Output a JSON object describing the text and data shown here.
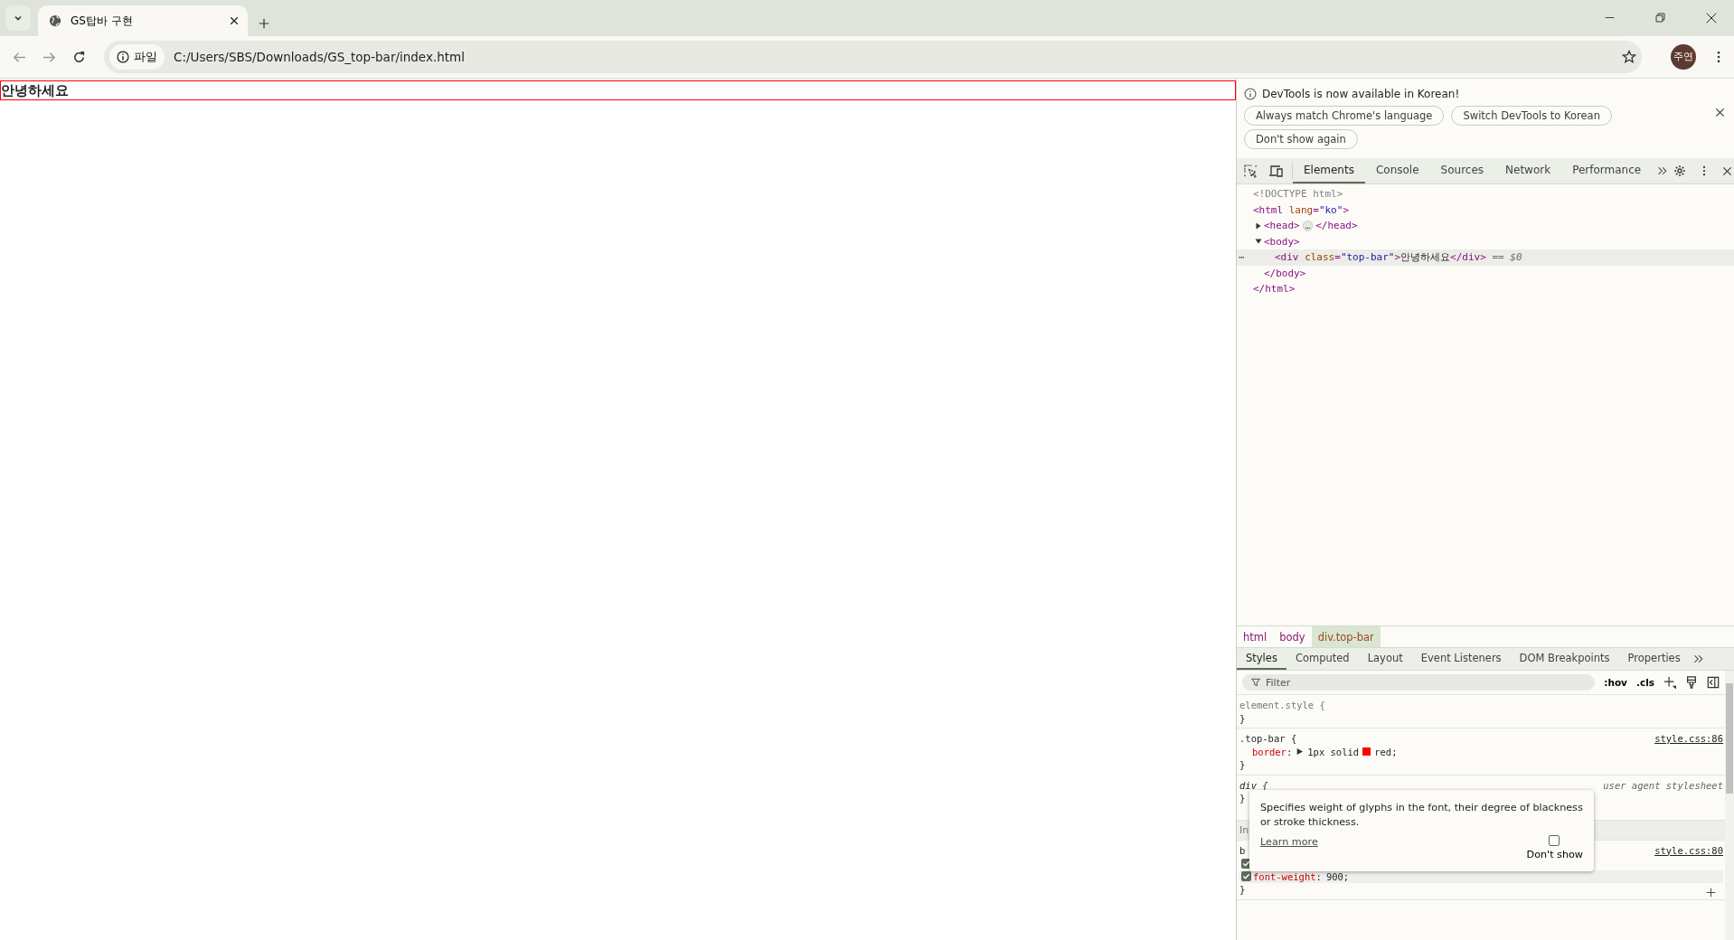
{
  "browser": {
    "tabs": [
      {
        "title": "GS탑바 구현",
        "selected": true
      }
    ],
    "address": {
      "chip": "파일",
      "url": "C:/Users/SBS/Downloads/GS_top-bar/index.html"
    },
    "profile": "주연"
  },
  "page": {
    "top_bar_text": "안녕하세요"
  },
  "devtools": {
    "infobar": {
      "message": "DevTools is now available in Korean!",
      "buttons": [
        "Always match Chrome's language",
        "Switch DevTools to Korean",
        "Don't show again"
      ]
    },
    "tabs": [
      {
        "label": "Elements",
        "selected": true
      },
      {
        "label": "Console",
        "selected": false
      },
      {
        "label": "Sources",
        "selected": false
      },
      {
        "label": "Network",
        "selected": false
      },
      {
        "label": "Performance",
        "selected": false
      }
    ],
    "tree": [
      {
        "selected": false,
        "segments": [
          {
            "kind": "doctype",
            "text": "<!DOCTYPE html>"
          }
        ]
      },
      {
        "selected": false,
        "segments": [
          {
            "kind": "tag",
            "text": "<html "
          },
          {
            "kind": "attr",
            "text": "lang"
          },
          {
            "kind": "tag",
            "text": "="
          },
          {
            "kind": "value",
            "text": "\"ko\""
          },
          {
            "kind": "tag",
            "text": ">"
          }
        ],
        "children": [
          {
            "selected": false,
            "expanded": false,
            "segments": [
              {
                "kind": "tag",
                "text": "<head>"
              },
              {
                "kind": "ellipsis",
                "text": "…"
              },
              {
                "kind": "tag",
                "text": "</head>"
              }
            ]
          },
          {
            "selected": false,
            "expanded": true,
            "segments": [
              {
                "kind": "tag",
                "text": "<body>"
              }
            ],
            "children": [
              {
                "selected": true,
                "marker": "⋯",
                "segments": [
                  {
                    "kind": "tag",
                    "text": "<div "
                  },
                  {
                    "kind": "attr",
                    "text": "class"
                  },
                  {
                    "kind": "tag",
                    "text": "="
                  },
                  {
                    "kind": "value",
                    "text": "\"top-bar\""
                  },
                  {
                    "kind": "tag",
                    "text": ">"
                  },
                  {
                    "kind": "text",
                    "text": "안녕하세요"
                  },
                  {
                    "kind": "tag",
                    "text": "</div>"
                  },
                  {
                    "kind": "ref",
                    "text": " == $0"
                  }
                ]
              }
            ],
            "closing": [
              {
                "kind": "tag",
                "text": "</body>"
              }
            ]
          }
        ],
        "closing": [
          {
            "kind": "tag",
            "text": "</html>"
          }
        ]
      }
    ],
    "breadcrumbs": [
      {
        "label": "html",
        "selected": false
      },
      {
        "label": "body",
        "selected": false
      },
      {
        "label": "div.top-bar",
        "selected": true
      }
    ],
    "subtabs": [
      {
        "label": "Styles",
        "selected": true
      },
      {
        "label": "Computed",
        "selected": false
      },
      {
        "label": "Layout",
        "selected": false
      },
      {
        "label": "Event Listeners",
        "selected": false
      },
      {
        "label": "DOM Breakpoints",
        "selected": false
      },
      {
        "label": "Properties",
        "selected": false
      }
    ],
    "filter": {
      "placeholder": "Filter"
    },
    "hov": ":hov",
    "cls": ".cls",
    "rules": [
      {
        "selector": "element.style {",
        "kind": "inline",
        "close": "}"
      },
      {
        "selector": ".top-bar {",
        "kind": "normal",
        "source": "style.css:86",
        "close": "}",
        "declarations": [
          {
            "property": "border",
            "separator": ":",
            "expandable": true,
            "value": "1px solid",
            "color": "#ff0000",
            "value_after": "red;"
          }
        ]
      },
      {
        "selector": "div {",
        "kind": "agent",
        "source": "user agent stylesheet",
        "close": "}"
      },
      {
        "selector": "In",
        "kind": "section"
      },
      {
        "selector": "b",
        "kind": "normal",
        "source": "style.css:80",
        "close": "}",
        "add": true,
        "declarations": [
          {
            "checked": true
          },
          {
            "property": "font-weight",
            "separator": ":",
            "checked": true,
            "value": "900;",
            "highlight": true
          }
        ]
      }
    ],
    "tooltip": {
      "text": "Specifies weight of glyphs in the font, their degree of blackness or stroke thickness.",
      "link": "Learn more",
      "checkbox_label": "Don't show",
      "checked": false
    }
  }
}
